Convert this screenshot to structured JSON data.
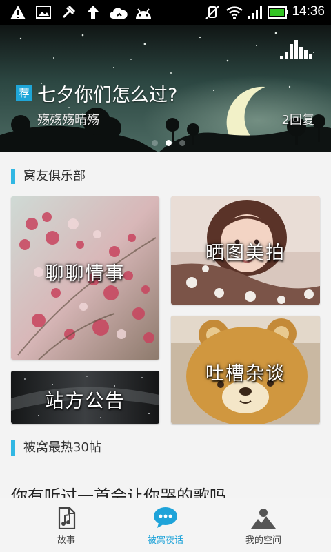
{
  "status_bar": {
    "time": "14:36",
    "left_icons": [
      "warning-icon",
      "image-icon",
      "usb-debug-icon",
      "upload-arrow-icon",
      "cloud-sync-icon",
      "android-icon"
    ],
    "right_icons": [
      "mute-icon",
      "wifi-icon",
      "signal-icon",
      "battery-icon"
    ]
  },
  "banner": {
    "badge": "荐",
    "title": "七夕你们怎么过?",
    "author": "殇殇殇晴殇",
    "replies": "2回复",
    "dots_count": 3,
    "active_dot": 1,
    "icon": "bar-chart-icon"
  },
  "sections": {
    "club": {
      "title": "窝友俱乐部"
    },
    "hot": {
      "title": "被窝最热30帖"
    }
  },
  "tiles": {
    "chat": {
      "label": "聊聊情事"
    },
    "photo": {
      "label": "晒图美拍"
    },
    "notice": {
      "label": "站方公告"
    },
    "gossip": {
      "label": "吐槽杂谈"
    }
  },
  "post": {
    "title": "你有听过一首会让你哭的歌吗"
  },
  "nav": {
    "items": [
      {
        "label": "故事",
        "icon": "music-file-icon"
      },
      {
        "label": "被窝夜话",
        "icon": "chat-bubble-icon"
      },
      {
        "label": "我的空间",
        "icon": "landscape-icon"
      }
    ],
    "active_index": 1
  },
  "colors": {
    "accent": "#31b7e3",
    "nav_active": "#1ea3d9",
    "badge": "#1fa6d8"
  }
}
